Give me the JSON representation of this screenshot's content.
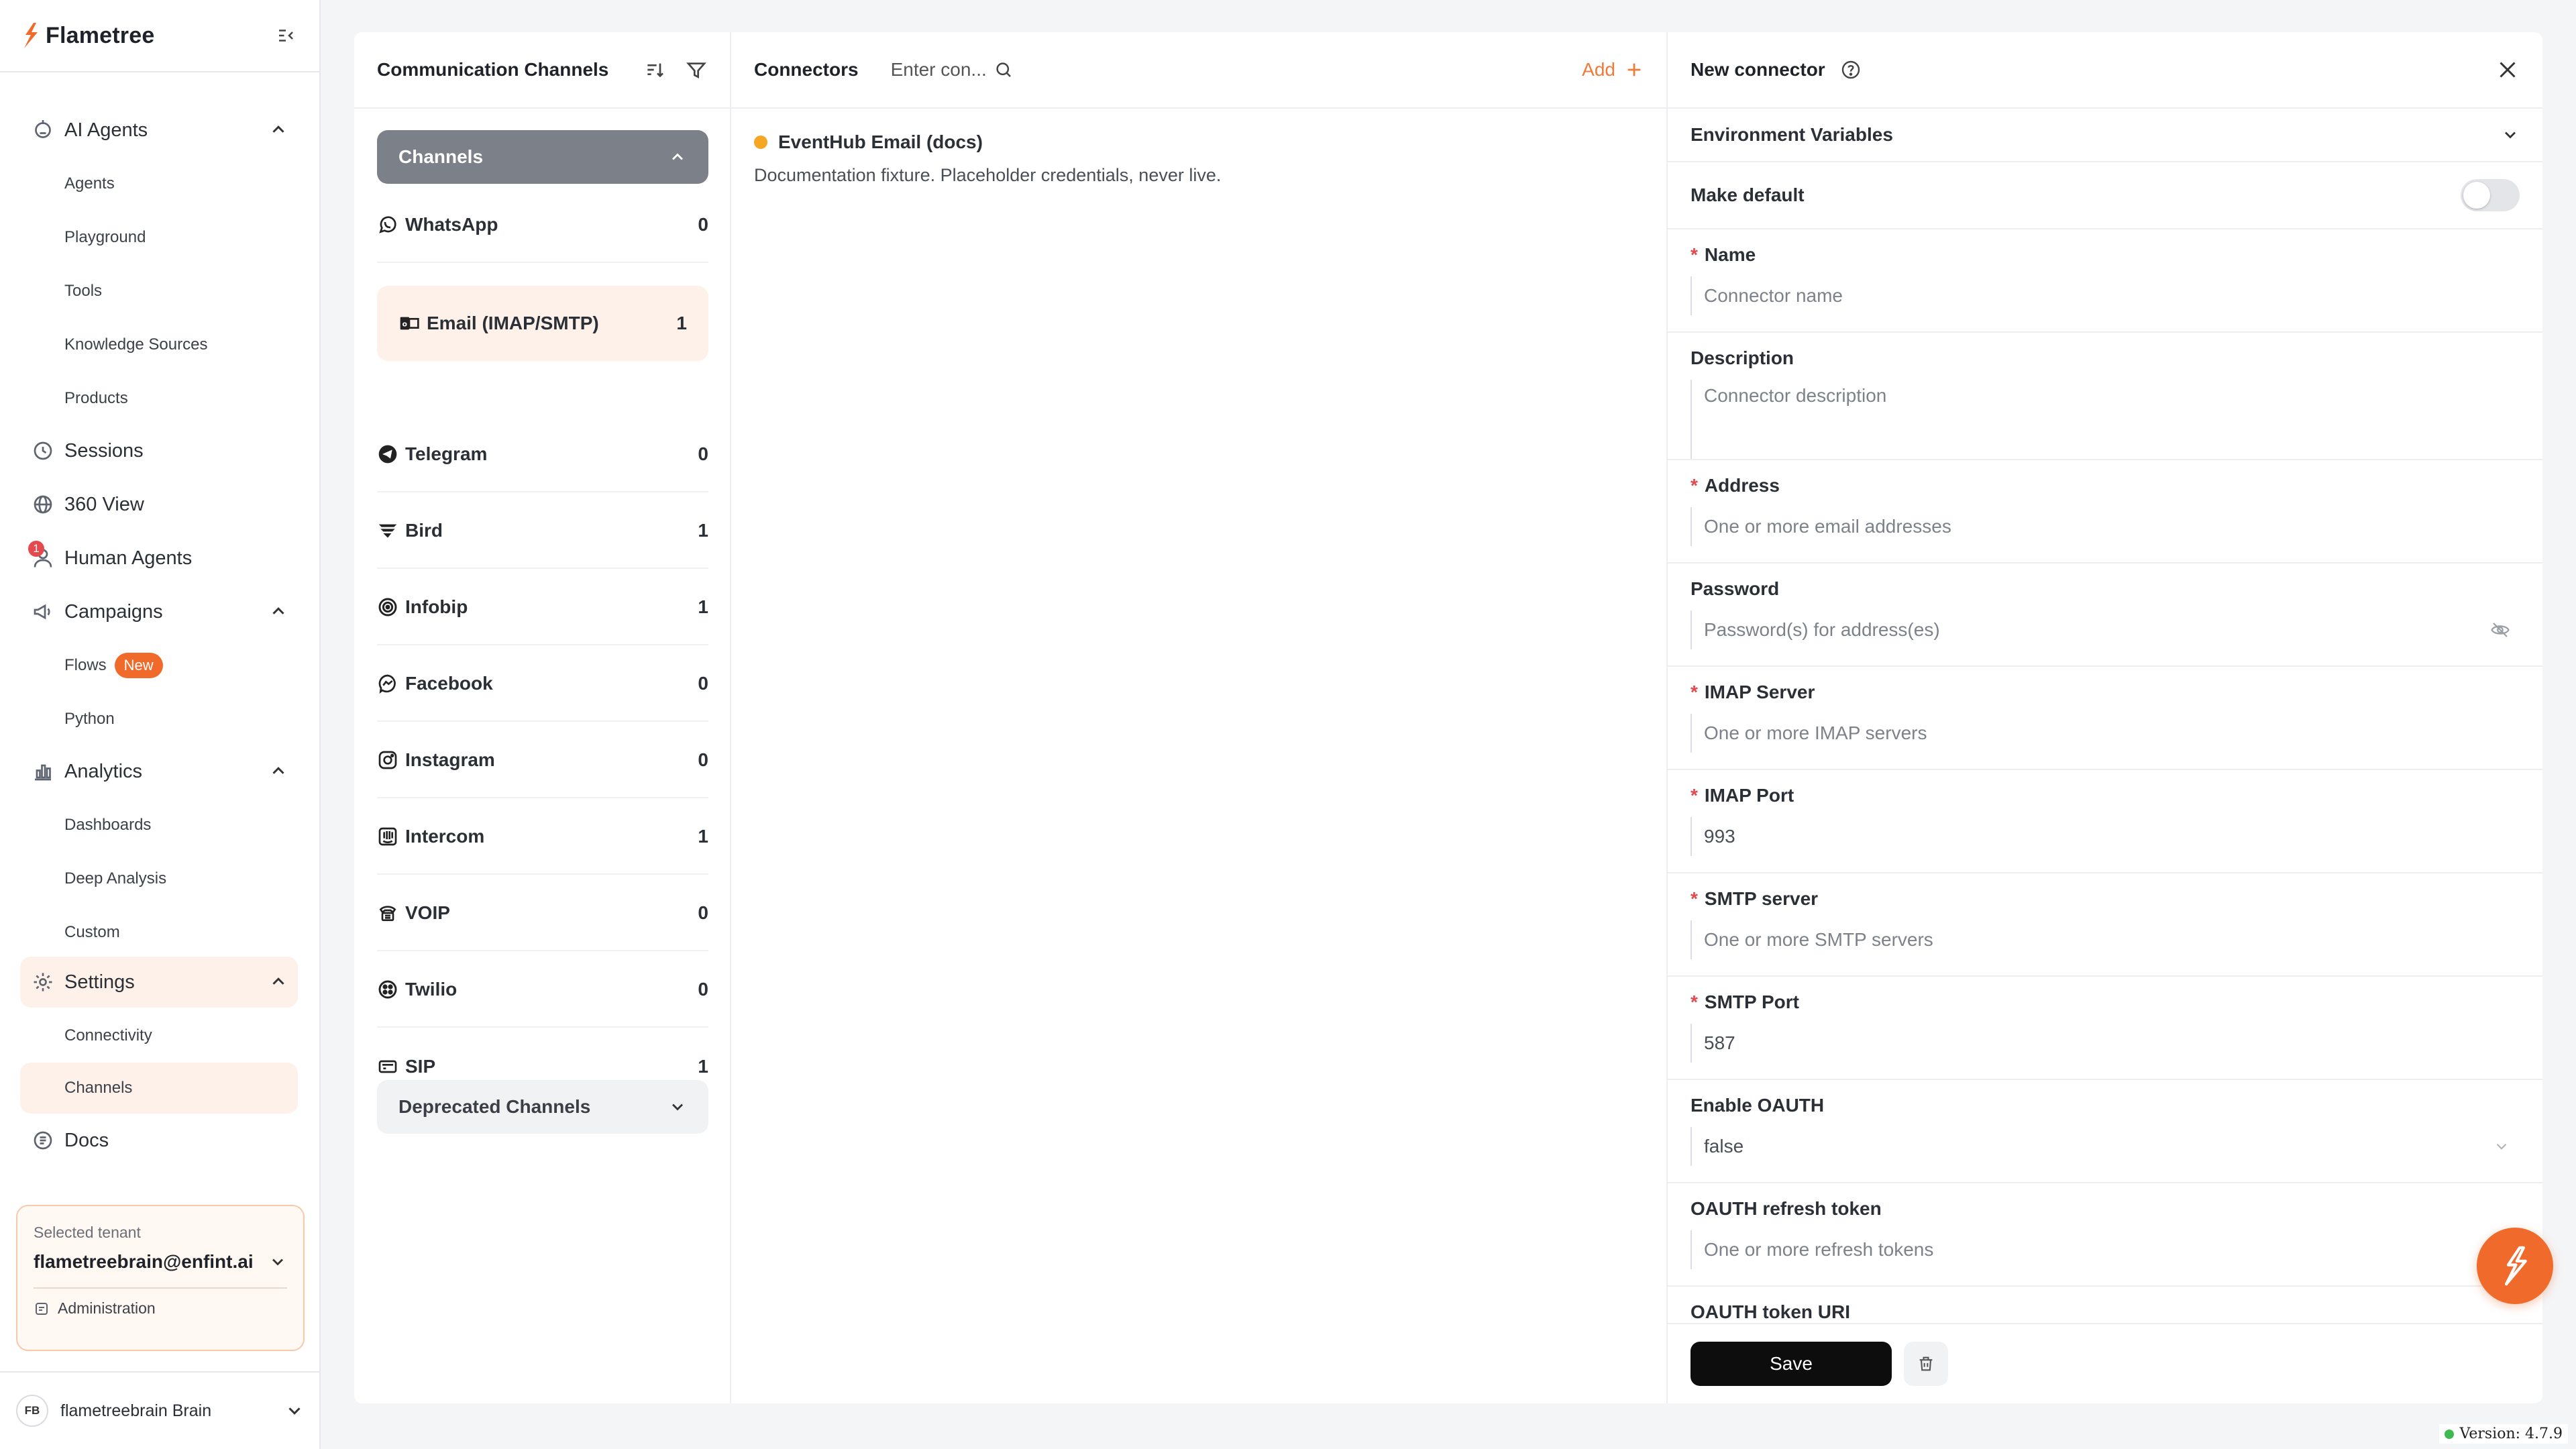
{
  "app": {
    "name": "Flametree"
  },
  "sidebar": {
    "nav": [
      {
        "id": "ai_agents",
        "label": "AI Agents",
        "icon": "robot-icon"
      },
      {
        "id": "agents",
        "label": "Agents"
      },
      {
        "id": "playground",
        "label": "Playground"
      },
      {
        "id": "tools",
        "label": "Tools"
      },
      {
        "id": "knowledge",
        "label": "Knowledge Sources"
      },
      {
        "id": "products",
        "label": "Products"
      },
      {
        "id": "sessions",
        "label": "Sessions",
        "icon": "history-icon"
      },
      {
        "id": "view360",
        "label": "360 View",
        "icon": "globe-icon"
      },
      {
        "id": "human_agents",
        "label": "Human Agents",
        "icon": "user-icon",
        "badge": "1"
      },
      {
        "id": "campaigns",
        "label": "Campaigns",
        "icon": "megaphone-icon"
      },
      {
        "id": "flows",
        "label": "Flows",
        "badge": "New"
      },
      {
        "id": "python",
        "label": "Python"
      },
      {
        "id": "analytics",
        "label": "Analytics",
        "icon": "bar-chart-icon"
      },
      {
        "id": "dashboards",
        "label": "Dashboards"
      },
      {
        "id": "deep_analysis",
        "label": "Deep Analysis"
      },
      {
        "id": "custom",
        "label": "Custom"
      },
      {
        "id": "settings",
        "label": "Settings",
        "icon": "gear-icon"
      },
      {
        "id": "connectivity",
        "label": "Connectivity"
      },
      {
        "id": "channels",
        "label": "Channels"
      },
      {
        "id": "docs",
        "label": "Docs",
        "icon": "docs-icon"
      }
    ],
    "tenant": {
      "label": "Selected tenant",
      "value": "flametreebrain@enfint.ai",
      "admin_label": "Administration"
    },
    "user": {
      "initials": "FB",
      "name": "flametreebrain Brain"
    }
  },
  "channels": {
    "title": "Communication Channels",
    "group_label": "Channels",
    "deprecated_label": "Deprecated Channels",
    "items": [
      {
        "name": "WhatsApp",
        "count": "0",
        "icon": "whatsapp-icon"
      },
      {
        "name": "Email (IMAP/SMTP)",
        "count": "1",
        "icon": "email-icon"
      },
      {
        "name": "Telegram",
        "count": "0",
        "icon": "telegram-icon"
      },
      {
        "name": "Bird",
        "count": "1",
        "icon": "bird-icon"
      },
      {
        "name": "Infobip",
        "count": "1",
        "icon": "infobip-icon"
      },
      {
        "name": "Facebook",
        "count": "0",
        "icon": "messenger-icon"
      },
      {
        "name": "Instagram",
        "count": "0",
        "icon": "instagram-icon"
      },
      {
        "name": "Intercom",
        "count": "1",
        "icon": "intercom-icon"
      },
      {
        "name": "VOIP",
        "count": "0",
        "icon": "voip-icon"
      },
      {
        "name": "Twilio",
        "count": "0",
        "icon": "twilio-icon"
      },
      {
        "name": "SIP",
        "count": "1",
        "icon": "sip-icon"
      }
    ]
  },
  "connectors": {
    "title": "Connectors",
    "search_placeholder": "Enter con...",
    "add_label": "Add",
    "items": [
      {
        "title": "EventHub Email (docs)",
        "description": "Documentation fixture. Placeholder credentials, never live.",
        "status_color": "#f5a623"
      }
    ]
  },
  "form": {
    "title": "New connector",
    "env_label": "Environment Variables",
    "default_label": "Make default",
    "fields": {
      "name": {
        "label": "Name",
        "placeholder": "Connector name"
      },
      "description": {
        "label": "Description",
        "placeholder": "Connector description"
      },
      "address": {
        "label": "Address",
        "placeholder": "One or more email addresses"
      },
      "password": {
        "label": "Password",
        "placeholder": "Password(s) for address(es)"
      },
      "imap_server": {
        "label": "IMAP Server",
        "placeholder": "One or more IMAP servers"
      },
      "imap_port": {
        "label": "IMAP Port",
        "value": "993"
      },
      "smtp_server": {
        "label": "SMTP server",
        "placeholder": "One or more SMTP servers"
      },
      "smtp_port": {
        "label": "SMTP Port",
        "value": "587"
      },
      "enable_oauth": {
        "label": "Enable OAUTH",
        "value": "false"
      },
      "oauth_refresh": {
        "label": "OAUTH refresh token",
        "placeholder": "One or more refresh tokens"
      },
      "oauth_uri": {
        "label": "OAUTH token URI"
      }
    },
    "save_label": "Save"
  },
  "version": "Version: 4.7.9",
  "colors": {
    "accent": "#f06b2b",
    "status_ok": "#3fb950"
  }
}
